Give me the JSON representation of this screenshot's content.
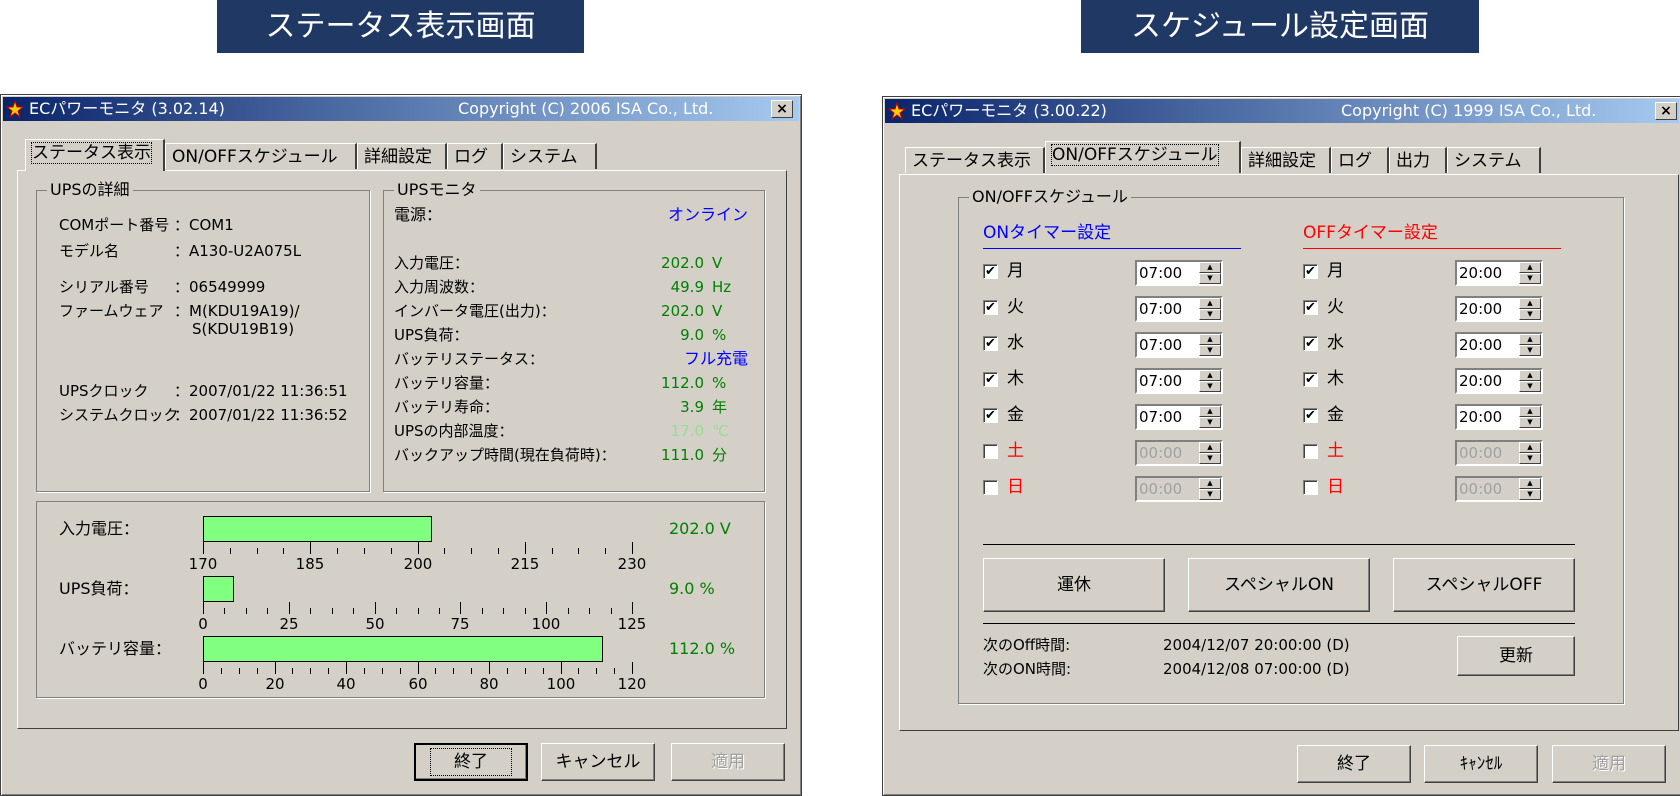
{
  "captions": {
    "left": "ステータス表示画面",
    "right": "スケジュール設定画面"
  },
  "left_window": {
    "title": "ECパワーモニタ (3.02.14)",
    "copyright": "Copyright (C) 2006 ISA Co., Ltd.",
    "close": "×",
    "tabs": [
      "ステータス表示",
      "ON/OFFスケジュール",
      "詳細設定",
      "ログ",
      "システム"
    ],
    "details_group": {
      "title": "UPSの詳細",
      "rows": [
        {
          "label": "COMポート番号",
          "value": "：COM1"
        },
        {
          "label": "モデル名",
          "value": "：A130-U2A075L"
        },
        {
          "label": "シリアル番号",
          "value": "：06549999"
        },
        {
          "label": "ファームウェア",
          "value": "：M(KDU19A19)/"
        },
        {
          "label": "",
          "value": "S(KDU19B19)"
        },
        {
          "label": "UPSクロック",
          "value": "：2007/01/22 11:36:51"
        },
        {
          "label": "システムクロック",
          "value": "：2007/01/22 11:36:52"
        }
      ]
    },
    "monitor_group": {
      "title": "UPSモニタ",
      "power_label": "電源：",
      "power_value": "オンライン",
      "rows": [
        {
          "label": "入力電圧：",
          "value": "202.0",
          "unit": "V"
        },
        {
          "label": "入力周波数：",
          "value": "49.9",
          "unit": "Hz"
        },
        {
          "label": "インバータ電圧(出力)：",
          "value": "202.0",
          "unit": "V"
        },
        {
          "label": "UPS負荷：",
          "value": "9.0",
          "unit": "%"
        },
        {
          "label": "バッテリステータス：",
          "value": "フル充電",
          "unit": ""
        },
        {
          "label": "バッテリ容量：",
          "value": "112.0",
          "unit": "%"
        },
        {
          "label": "バッテリ寿命：",
          "value": "3.9",
          "unit": "年"
        },
        {
          "label": "UPSの内部温度：",
          "value": "17.0",
          "unit": "℃"
        },
        {
          "label": "バックアップ時間(現在負荷時)：",
          "value": "111.0",
          "unit": "分"
        }
      ]
    },
    "bars": [
      {
        "label": "入力電圧：",
        "readout": "202.0 V",
        "min": 170,
        "max": 230,
        "value": 202.0,
        "ticks": [
          "170",
          "185",
          "200",
          "215",
          "230"
        ]
      },
      {
        "label": "UPS負荷：",
        "readout": "9.0 %",
        "min": 0,
        "max": 125,
        "value": 9.0,
        "ticks": [
          "0",
          "25",
          "50",
          "75",
          "100",
          "125"
        ]
      },
      {
        "label": "バッテリ容量：",
        "readout": "112.0 %",
        "min": 0,
        "max": 120,
        "value": 112.0,
        "ticks": [
          "0",
          "20",
          "40",
          "60",
          "80",
          "100",
          "120"
        ]
      }
    ],
    "buttons": {
      "ok": "終了",
      "cancel": "キャンセル",
      "apply": "適用"
    }
  },
  "right_window": {
    "title": "ECパワーモニタ (3.00.22)",
    "copyright": "Copyright (C) 1999 ISA Co., Ltd.",
    "close": "×",
    "tabs": [
      "ステータス表示",
      "ON/OFFスケジュール",
      "詳細設定",
      "ログ",
      "出力",
      "システム"
    ],
    "group_title": "ON/OFFスケジュール",
    "on_header": "ONタイマー設定",
    "off_header": "OFFタイマー設定",
    "days": [
      {
        "day": "月",
        "on_checked": true,
        "on_time": "07:00",
        "off_checked": true,
        "off_time": "20:00"
      },
      {
        "day": "火",
        "on_checked": true,
        "on_time": "07:00",
        "off_checked": true,
        "off_time": "20:00"
      },
      {
        "day": "水",
        "on_checked": true,
        "on_time": "07:00",
        "off_checked": true,
        "off_time": "20:00"
      },
      {
        "day": "木",
        "on_checked": true,
        "on_time": "07:00",
        "off_checked": true,
        "off_time": "20:00"
      },
      {
        "day": "金",
        "on_checked": true,
        "on_time": "07:00",
        "off_checked": true,
        "off_time": "20:00"
      },
      {
        "day": "土",
        "on_checked": false,
        "on_time": "00:00",
        "off_checked": false,
        "off_time": "00:00"
      },
      {
        "day": "日",
        "on_checked": false,
        "on_time": "00:00",
        "off_checked": false,
        "off_time": "00:00"
      }
    ],
    "action_buttons": {
      "rest": "運休",
      "special_on": "スペシャルON",
      "special_off": "スペシャルOFF"
    },
    "next_off_label": "次のOff時間:",
    "next_off_value": "2004/12/07 20:00:00 (D)",
    "next_on_label": "次のON時間:",
    "next_on_value": "2004/12/08 07:00:00 (D)",
    "refresh": "更新",
    "buttons": {
      "ok": "終了",
      "cancel": "ｷｬﾝｾﾙ",
      "apply": "適用"
    }
  },
  "colors": {
    "caption_bg": "#1f3864",
    "value_green": "#008000",
    "bar_green": "#80ff80",
    "weekend_red": "#ff0000",
    "on_blue": "#0000ff"
  }
}
